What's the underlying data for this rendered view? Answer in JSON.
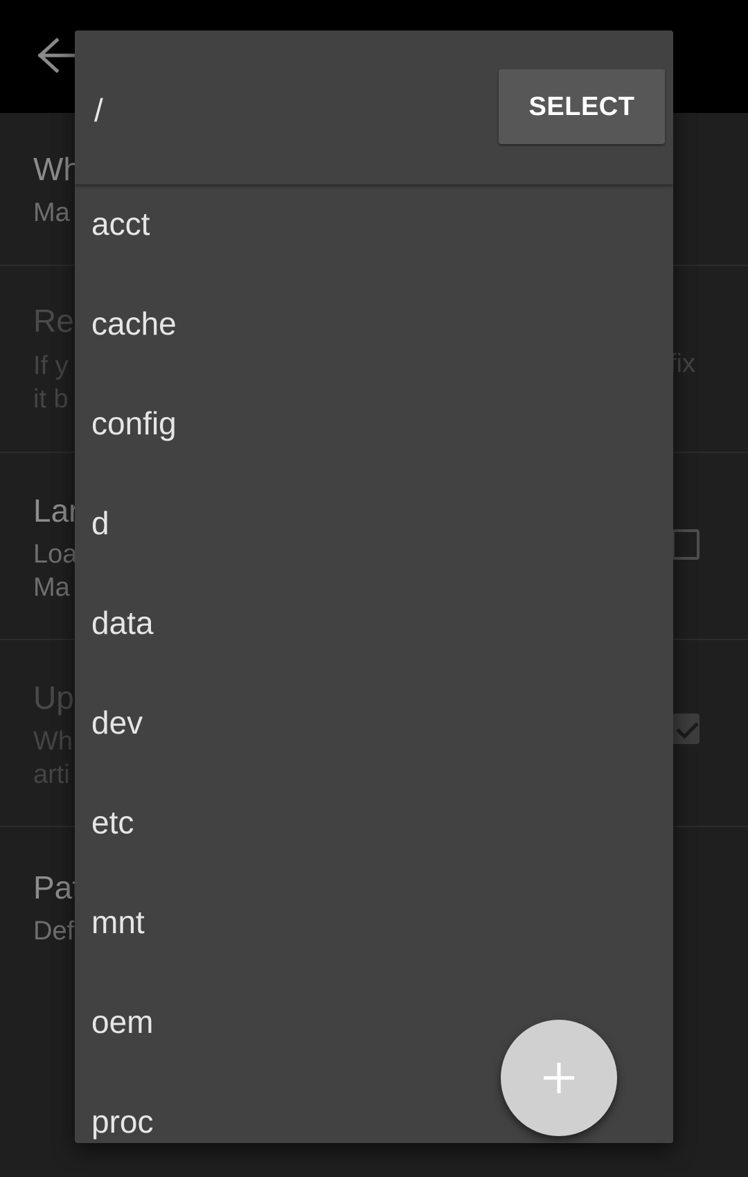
{
  "background": {
    "preferences": [
      {
        "title": "Wh",
        "summary": [
          "Ma"
        ],
        "enabled": true
      },
      {
        "title": "Re",
        "summary": [
          "If y",
          "it b"
        ],
        "trailing": "fix",
        "enabled": false
      },
      {
        "title": "Lar",
        "summary": [
          "Loa",
          "Ma"
        ],
        "checkbox": false,
        "enabled": true
      },
      {
        "title": "Up",
        "summary": [
          "Wh",
          "arti"
        ],
        "checkbox": true,
        "enabled": false
      },
      {
        "title": "Pat",
        "summary": [
          "Def"
        ],
        "enabled": true
      }
    ]
  },
  "dialog": {
    "current_path": "/",
    "select_label": "SELECT",
    "directories": [
      "acct",
      "cache",
      "config",
      "d",
      "data",
      "dev",
      "etc",
      "mnt",
      "oem",
      "proc"
    ],
    "fab_icon": "plus-icon"
  },
  "icons": {
    "back": "arrow-left-icon",
    "add": "plus-icon"
  },
  "colors": {
    "dialog_bg": "#424242",
    "button_bg": "#575757",
    "fab_bg": "#d0d0d0",
    "appbar_bg": "#000000"
  }
}
